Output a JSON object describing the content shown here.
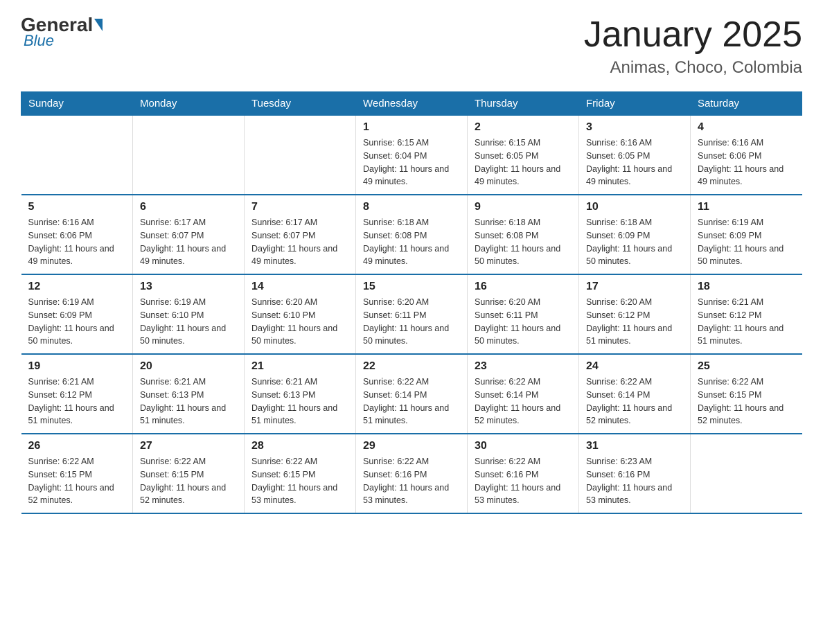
{
  "header": {
    "logo_general": "General",
    "logo_blue": "Blue",
    "title": "January 2025",
    "subtitle": "Animas, Choco, Colombia"
  },
  "days_of_week": [
    "Sunday",
    "Monday",
    "Tuesday",
    "Wednesday",
    "Thursday",
    "Friday",
    "Saturday"
  ],
  "weeks": [
    [
      {
        "day": "",
        "info": ""
      },
      {
        "day": "",
        "info": ""
      },
      {
        "day": "",
        "info": ""
      },
      {
        "day": "1",
        "info": "Sunrise: 6:15 AM\nSunset: 6:04 PM\nDaylight: 11 hours and 49 minutes."
      },
      {
        "day": "2",
        "info": "Sunrise: 6:15 AM\nSunset: 6:05 PM\nDaylight: 11 hours and 49 minutes."
      },
      {
        "day": "3",
        "info": "Sunrise: 6:16 AM\nSunset: 6:05 PM\nDaylight: 11 hours and 49 minutes."
      },
      {
        "day": "4",
        "info": "Sunrise: 6:16 AM\nSunset: 6:06 PM\nDaylight: 11 hours and 49 minutes."
      }
    ],
    [
      {
        "day": "5",
        "info": "Sunrise: 6:16 AM\nSunset: 6:06 PM\nDaylight: 11 hours and 49 minutes."
      },
      {
        "day": "6",
        "info": "Sunrise: 6:17 AM\nSunset: 6:07 PM\nDaylight: 11 hours and 49 minutes."
      },
      {
        "day": "7",
        "info": "Sunrise: 6:17 AM\nSunset: 6:07 PM\nDaylight: 11 hours and 49 minutes."
      },
      {
        "day": "8",
        "info": "Sunrise: 6:18 AM\nSunset: 6:08 PM\nDaylight: 11 hours and 49 minutes."
      },
      {
        "day": "9",
        "info": "Sunrise: 6:18 AM\nSunset: 6:08 PM\nDaylight: 11 hours and 50 minutes."
      },
      {
        "day": "10",
        "info": "Sunrise: 6:18 AM\nSunset: 6:09 PM\nDaylight: 11 hours and 50 minutes."
      },
      {
        "day": "11",
        "info": "Sunrise: 6:19 AM\nSunset: 6:09 PM\nDaylight: 11 hours and 50 minutes."
      }
    ],
    [
      {
        "day": "12",
        "info": "Sunrise: 6:19 AM\nSunset: 6:09 PM\nDaylight: 11 hours and 50 minutes."
      },
      {
        "day": "13",
        "info": "Sunrise: 6:19 AM\nSunset: 6:10 PM\nDaylight: 11 hours and 50 minutes."
      },
      {
        "day": "14",
        "info": "Sunrise: 6:20 AM\nSunset: 6:10 PM\nDaylight: 11 hours and 50 minutes."
      },
      {
        "day": "15",
        "info": "Sunrise: 6:20 AM\nSunset: 6:11 PM\nDaylight: 11 hours and 50 minutes."
      },
      {
        "day": "16",
        "info": "Sunrise: 6:20 AM\nSunset: 6:11 PM\nDaylight: 11 hours and 50 minutes."
      },
      {
        "day": "17",
        "info": "Sunrise: 6:20 AM\nSunset: 6:12 PM\nDaylight: 11 hours and 51 minutes."
      },
      {
        "day": "18",
        "info": "Sunrise: 6:21 AM\nSunset: 6:12 PM\nDaylight: 11 hours and 51 minutes."
      }
    ],
    [
      {
        "day": "19",
        "info": "Sunrise: 6:21 AM\nSunset: 6:12 PM\nDaylight: 11 hours and 51 minutes."
      },
      {
        "day": "20",
        "info": "Sunrise: 6:21 AM\nSunset: 6:13 PM\nDaylight: 11 hours and 51 minutes."
      },
      {
        "day": "21",
        "info": "Sunrise: 6:21 AM\nSunset: 6:13 PM\nDaylight: 11 hours and 51 minutes."
      },
      {
        "day": "22",
        "info": "Sunrise: 6:22 AM\nSunset: 6:14 PM\nDaylight: 11 hours and 51 minutes."
      },
      {
        "day": "23",
        "info": "Sunrise: 6:22 AM\nSunset: 6:14 PM\nDaylight: 11 hours and 52 minutes."
      },
      {
        "day": "24",
        "info": "Sunrise: 6:22 AM\nSunset: 6:14 PM\nDaylight: 11 hours and 52 minutes."
      },
      {
        "day": "25",
        "info": "Sunrise: 6:22 AM\nSunset: 6:15 PM\nDaylight: 11 hours and 52 minutes."
      }
    ],
    [
      {
        "day": "26",
        "info": "Sunrise: 6:22 AM\nSunset: 6:15 PM\nDaylight: 11 hours and 52 minutes."
      },
      {
        "day": "27",
        "info": "Sunrise: 6:22 AM\nSunset: 6:15 PM\nDaylight: 11 hours and 52 minutes."
      },
      {
        "day": "28",
        "info": "Sunrise: 6:22 AM\nSunset: 6:15 PM\nDaylight: 11 hours and 53 minutes."
      },
      {
        "day": "29",
        "info": "Sunrise: 6:22 AM\nSunset: 6:16 PM\nDaylight: 11 hours and 53 minutes."
      },
      {
        "day": "30",
        "info": "Sunrise: 6:22 AM\nSunset: 6:16 PM\nDaylight: 11 hours and 53 minutes."
      },
      {
        "day": "31",
        "info": "Sunrise: 6:23 AM\nSunset: 6:16 PM\nDaylight: 11 hours and 53 minutes."
      },
      {
        "day": "",
        "info": ""
      }
    ]
  ]
}
